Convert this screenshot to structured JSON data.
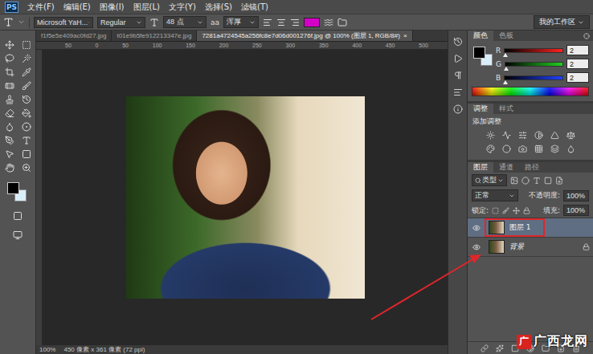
{
  "window": {
    "app_logo": "PS"
  },
  "menu": [
    "文件(F)",
    "编辑(E)",
    "图像(I)",
    "图层(L)",
    "文字(Y)",
    "选择(S)",
    "滤镜(T)"
  ],
  "options_bar": {
    "font_family": "Microsoft YaH...",
    "font_style": "Regular",
    "font_size": "48 点",
    "aa_icon": "aa",
    "antialias": "浑厚",
    "text_color": "#d400c8",
    "workspace": "我的工作区"
  },
  "document_tabs": [
    {
      "label": "f1f5e5e409ac0fd27.jpg",
      "selected": false,
      "close": ""
    },
    {
      "label": "t01e9b5fe912213347e.jpg",
      "selected": false,
      "close": ""
    },
    {
      "label": "7281a4724545a256fc8e7d06d001276f.jpg @ 100% (图层 1, RGB/8#)",
      "selected": true,
      "close": "×"
    }
  ],
  "ruler": [
    "50",
    "0",
    "50",
    "100",
    "150",
    "200",
    "250",
    "300",
    "350",
    "400",
    "450",
    "500"
  ],
  "color_panel": {
    "tabs": [
      {
        "label": "颜色",
        "selected": true
      },
      {
        "label": "色板",
        "selected": false
      }
    ],
    "channels": [
      {
        "name": "R",
        "value": "2",
        "level": 0.01,
        "color": "#ff2020"
      },
      {
        "name": "G",
        "value": "2",
        "level": 0.01,
        "color": "#20d020"
      },
      {
        "name": "B",
        "value": "2",
        "level": 0.01,
        "color": "#2040ff"
      }
    ]
  },
  "adjustments_panel": {
    "tabs": [
      {
        "label": "调整",
        "selected": true
      },
      {
        "label": "样式",
        "selected": false
      }
    ],
    "title": "添加调整"
  },
  "layers_panel": {
    "tabs": [
      {
        "label": "图层",
        "selected": true
      },
      {
        "label": "通道",
        "selected": false
      },
      {
        "label": "路径",
        "selected": false
      }
    ],
    "filter": "类型",
    "blend_mode": "正常",
    "opacity_label": "不透明度:",
    "opacity": "100%",
    "lock_label": "锁定:",
    "fill_label": "填充:",
    "fill": "100%",
    "layers": [
      {
        "name": "图层 1",
        "selected": true,
        "visible": true,
        "locked": false,
        "highlighted": true
      },
      {
        "name": "背景",
        "selected": false,
        "visible": true,
        "locked": true,
        "highlighted": false
      }
    ]
  },
  "status_bar": {
    "zoom": "100%",
    "info": "450 像素 x 361 像素 (72 ppi)"
  },
  "watermark": {
    "logo": "广",
    "text": "广西龙网"
  }
}
